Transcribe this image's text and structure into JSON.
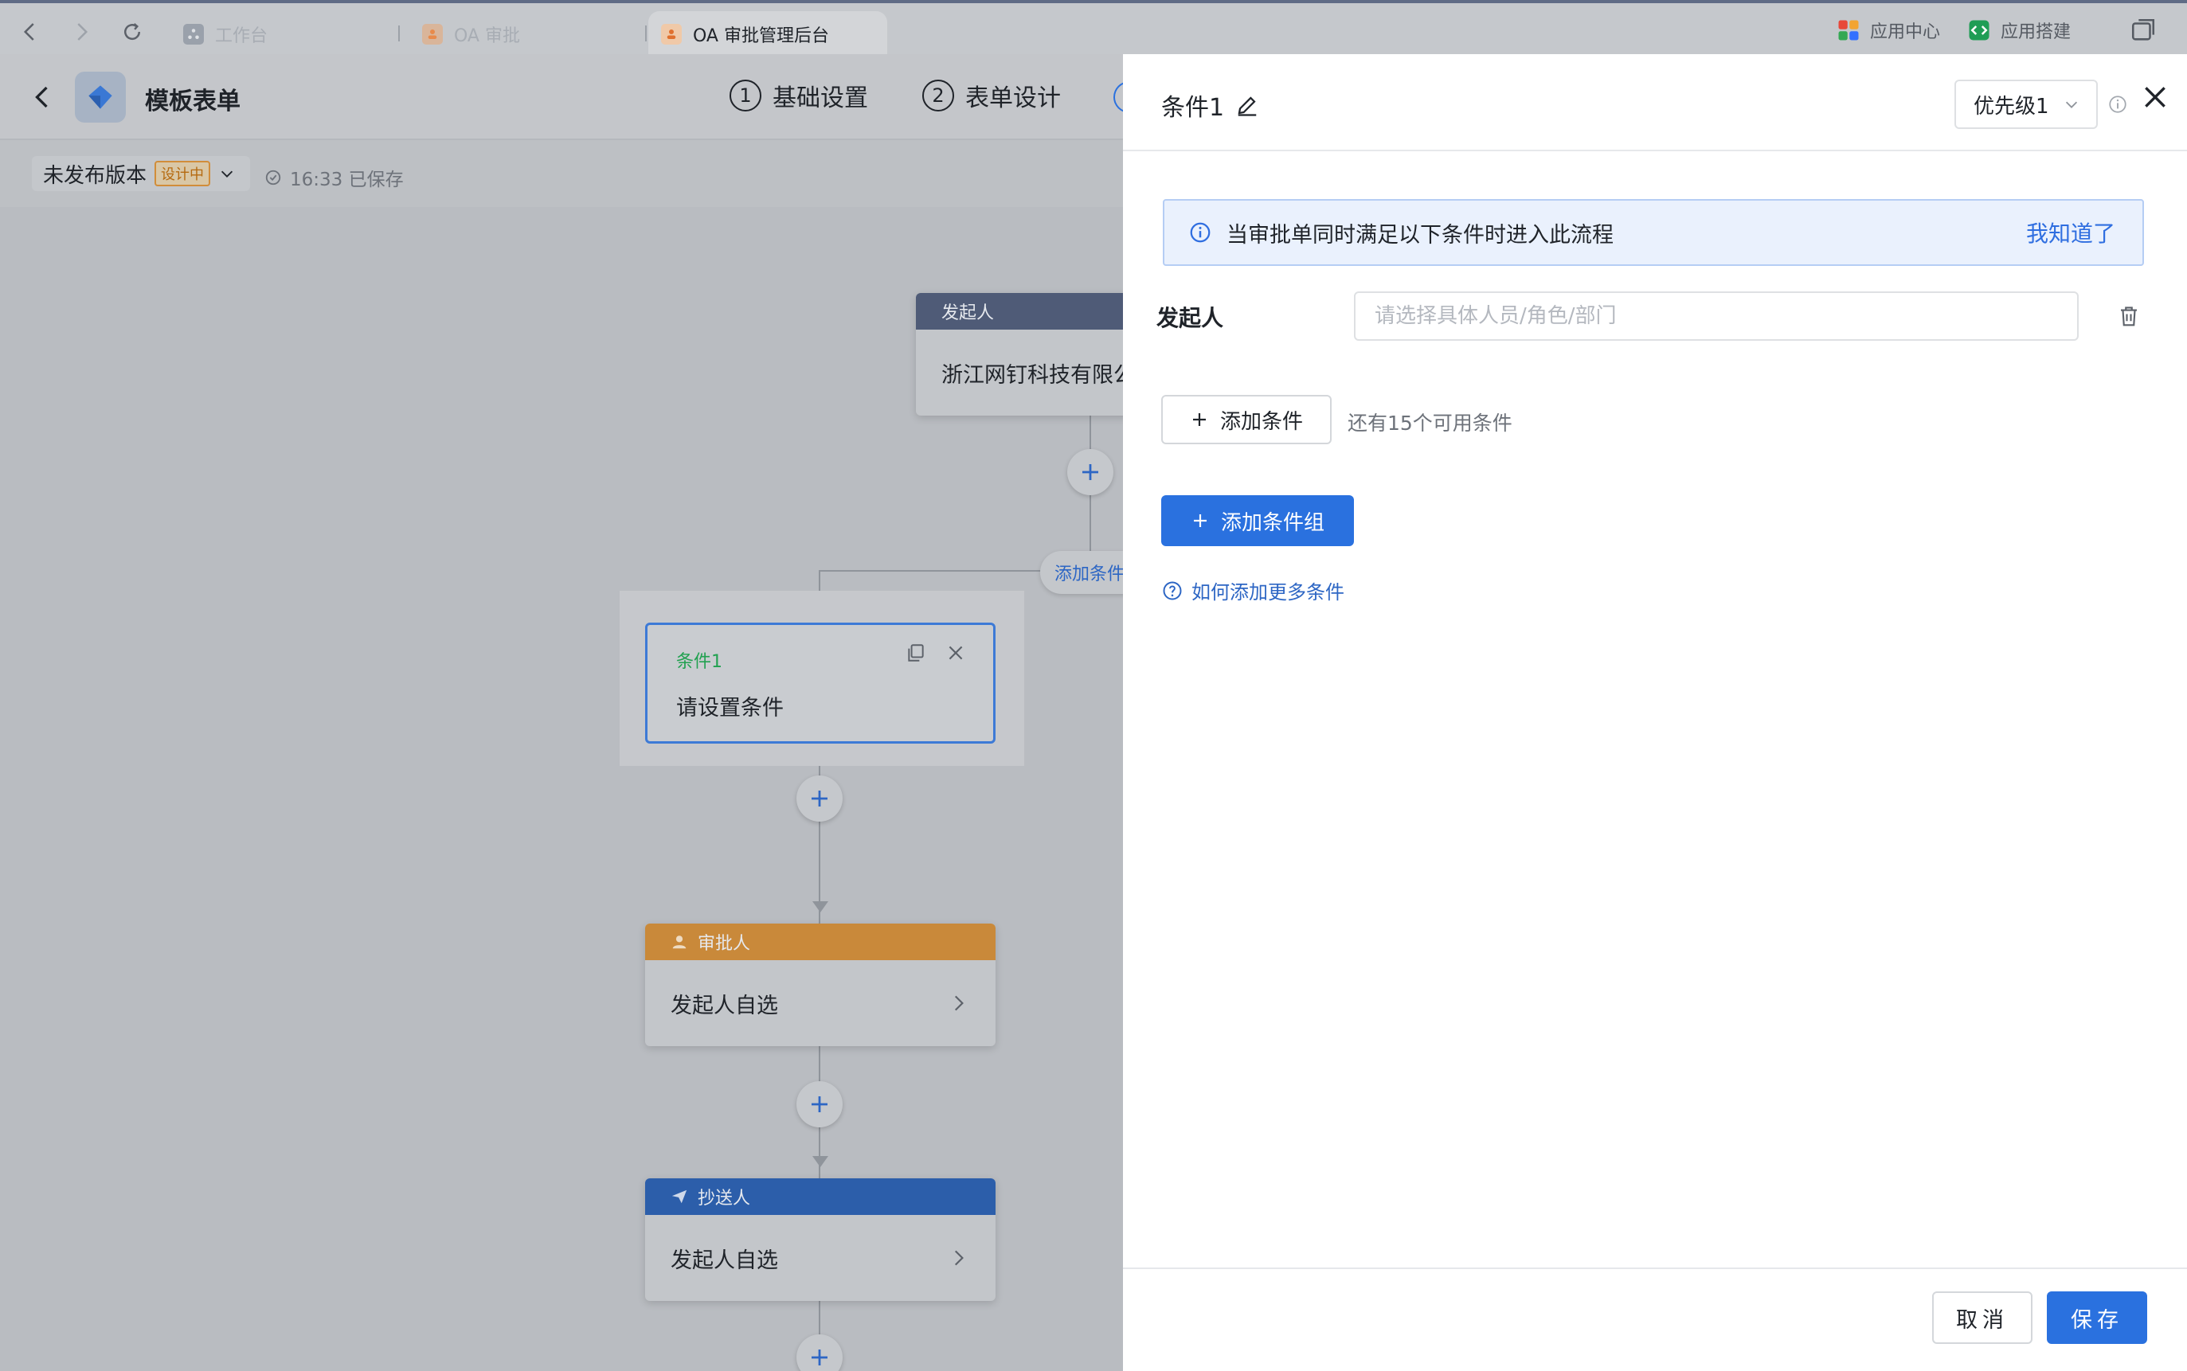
{
  "browser": {
    "tabs": [
      {
        "label": "工作台",
        "icon": "workbench-icon"
      },
      {
        "label": "OA 审批",
        "icon": "approval-icon"
      },
      {
        "label": "OA 审批管理后台",
        "icon": "approval-icon"
      }
    ],
    "right": {
      "app_center": "应用中心",
      "app_builder": "应用搭建"
    }
  },
  "header": {
    "title": "模板表单",
    "steps": [
      {
        "num": "1",
        "label": "基础设置"
      },
      {
        "num": "2",
        "label": "表单设计"
      }
    ]
  },
  "subbar": {
    "version": "未发布版本",
    "badge": "设计中",
    "saved": "16:33 已保存"
  },
  "flow": {
    "initiator": {
      "head": "发起人",
      "body": "浙江网钉科技有限公"
    },
    "add_condition": "添加条件",
    "condition": {
      "label": "条件1",
      "text": "请设置条件"
    },
    "approver": {
      "head": "审批人",
      "body": "发起人自选"
    },
    "cc": {
      "head": "抄送人",
      "body": "发起人自选"
    }
  },
  "drawer": {
    "title": "条件1",
    "priority": "优先级1",
    "notice": "当审批单同时满足以下条件时进入此流程",
    "notice_ack": "我知道了",
    "field_label": "发起人",
    "field_placeholder": "请选择具体人员/角色/部门",
    "add_condition": "添加条件",
    "remaining": "还有15个可用条件",
    "add_group": "添加条件组",
    "help": "如何添加更多条件",
    "cancel": "取消",
    "save": "保存"
  },
  "colors": {
    "primary": "#2a71df",
    "approver_head": "#c9893a",
    "cc_head": "#2c5eaa",
    "initiator_head": "#4f5b77",
    "condition_label": "#21a150"
  }
}
